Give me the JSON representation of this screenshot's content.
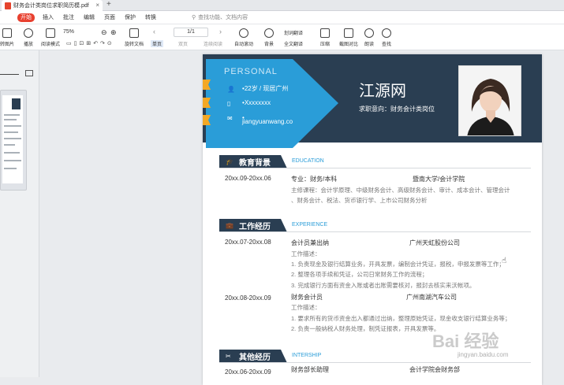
{
  "window": {
    "tab_title": "财务会计类岗位求职简历模.pdf",
    "tab_close": "×",
    "tab_add": "+"
  },
  "menu": {
    "active": "开始",
    "items": [
      "插入",
      "批注",
      "编辑",
      "页面",
      "保护",
      "转换"
    ],
    "search_placeholder": "查找功能、文档内容"
  },
  "toolbar": {
    "zoom": "75%",
    "page": "1/1",
    "labels": {
      "left_cut": "转图片",
      "play": "播放",
      "read_mode": "阅读模式",
      "rotate": "旋转文档",
      "single": "单页",
      "double": "双页",
      "continuous": "连续阅读",
      "autoscroll": "自动滚动",
      "background": "背景",
      "translate": "划词翻译",
      "full_translate": "全文翻译",
      "compress": "压缩",
      "screenshot": "截图对比",
      "read_aloud": "朗读",
      "find": "查找"
    }
  },
  "resume": {
    "personal": "PERSONAL",
    "age_location": "22岁 / 现居广州",
    "phone": "Xxxxxxxx",
    "email_bullet": "•",
    "email": "jiangyuanwang.co",
    "name": "江源网",
    "objective": "求职意向：财务会计类岗位",
    "sections": {
      "education": {
        "title": "教育背景",
        "en": "EDUCATION"
      },
      "experience": {
        "title": "工作经历",
        "en": "EXPERIENCE"
      },
      "other": {
        "title": "其他经历",
        "en": "INTERSHIP"
      }
    },
    "edu": {
      "date": "20xx.09-20xx.06",
      "major": "专业：财务/本科",
      "school": "暨南大学/会计学院",
      "courses1": "主修课程：会计学原理、中级财务会计、高级财务会计、审计、成本会计、管理会计",
      "courses2": "、财务会计、税法、货币银行学、上市公司财务分析"
    },
    "job1": {
      "date": "20xx.07-20xx.08",
      "role": "会计员兼出纳",
      "company": "广州天虹股份公司",
      "desc_label": "工作描述：",
      "d1": "1. 负责现金及银行结算业务，开具发票，编制会计凭证，报税，申报发票等工作；",
      "d2": "2. 整理各项手续和凭证，公司日常财务工作的流程；",
      "d3": "3. 完成银行方面有资金入账或者出账需要核对，报封去核实来沃帐项。"
    },
    "job2": {
      "date": "20xx.08-20xx.09",
      "role": "财务会计员",
      "company": "广州南湖汽车公司",
      "desc_label": "工作描述：",
      "d1": "1. 要求所有的货币资金出入都通过出纳，整理原始凭证，现金收支银行结算业务等；",
      "d2": "2. 负责一般纳税人财务处理，制凭证报表，开具发票等。"
    },
    "other1": {
      "date": "20xx.06-20xx.09",
      "role": "财务部长助理",
      "company": "会计学院会财务部"
    }
  },
  "watermark": {
    "main": "Bai 经验",
    "sub": "jingyan.baidu.com"
  }
}
